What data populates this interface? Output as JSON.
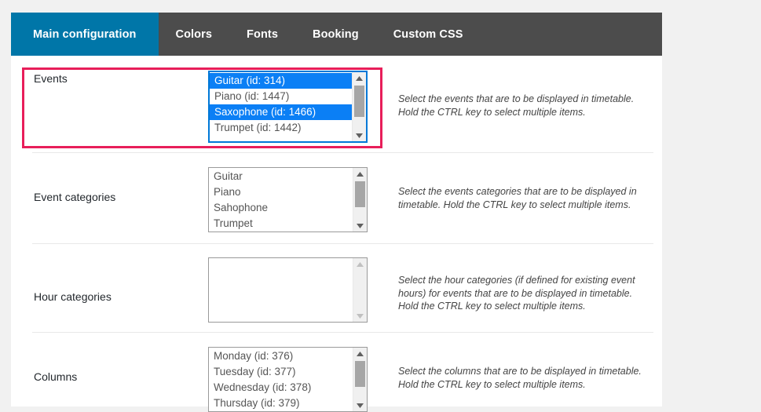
{
  "tabs": [
    {
      "label": "Main configuration",
      "active": true
    },
    {
      "label": "Colors",
      "active": false
    },
    {
      "label": "Fonts",
      "active": false
    },
    {
      "label": "Booking",
      "active": false
    },
    {
      "label": "Custom CSS",
      "active": false
    }
  ],
  "colors": {
    "active_tab_background": "#0076a8",
    "tab_bar_background": "#4c4c4c",
    "page_background": "#f1f1f1",
    "panel_background": "#ffffff",
    "selection_highlight": "#0b7ff5",
    "focus_border": "#0078d7",
    "annotation_border": "#e81e5a",
    "label_text": "#23282d",
    "option_text": "#555555",
    "description_text": "#444444"
  },
  "rows": [
    {
      "label": "Events",
      "description": "Select the events that are to be displayed in timetable. Hold the CTRL key to select multiple items.",
      "focused": true,
      "scroll_enabled": true,
      "options": [
        {
          "label": "Guitar (id: 314)",
          "selected": true
        },
        {
          "label": "Piano (id: 1447)",
          "selected": false
        },
        {
          "label": "Saxophone (id: 1466)",
          "selected": true
        },
        {
          "label": "Trumpet (id: 1442)",
          "selected": false
        }
      ]
    },
    {
      "label": "Event categories",
      "description": "Select the events categories that are to be displayed in timetable. Hold the CTRL key to select multiple items.",
      "focused": false,
      "scroll_enabled": true,
      "options": [
        {
          "label": "Guitar",
          "selected": false
        },
        {
          "label": "Piano",
          "selected": false
        },
        {
          "label": "Sahophone",
          "selected": false
        },
        {
          "label": "Trumpet",
          "selected": false
        }
      ]
    },
    {
      "label": "Hour categories",
      "description": "Select the hour categories (if defined for existing event hours) for events that are to be displayed in timetable. Hold the CTRL key to select multiple items.",
      "focused": false,
      "scroll_enabled": false,
      "options": []
    },
    {
      "label": "Columns",
      "description": "Select the columns that are to be displayed in timetable. Hold the CTRL key to select multiple items.",
      "focused": false,
      "scroll_enabled": true,
      "options": [
        {
          "label": "Monday (id: 376)",
          "selected": false
        },
        {
          "label": "Tuesday (id: 377)",
          "selected": false
        },
        {
          "label": "Wednesday (id: 378)",
          "selected": false
        },
        {
          "label": "Thursday (id: 379)",
          "selected": false
        }
      ]
    }
  ],
  "annotation": {
    "target_row": "Events",
    "shape": "rectangle"
  }
}
